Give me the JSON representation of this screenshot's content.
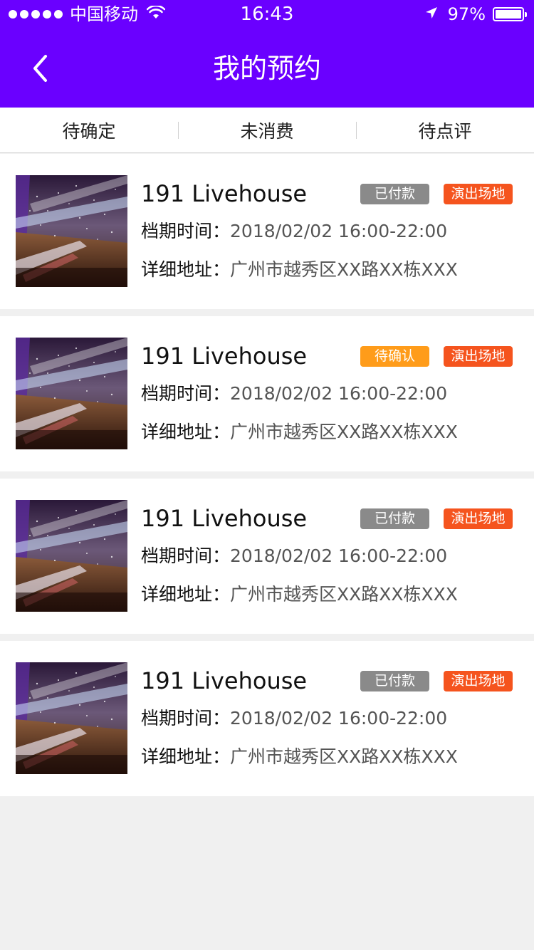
{
  "status_bar": {
    "carrier": "中国移动",
    "time": "16:43",
    "battery": "97%",
    "battery_level": 0.97,
    "signal_dots": 5,
    "icons": [
      "signal-dots-icon",
      "wifi-icon",
      "location-arrow-icon",
      "battery-icon"
    ]
  },
  "nav": {
    "title": "我的预约",
    "back_icon": "chevron-left-icon"
  },
  "tabs": [
    {
      "label": "待确定"
    },
    {
      "label": "未消费"
    },
    {
      "label": "待点评"
    }
  ],
  "list": {
    "items": [
      {
        "name": "191 Livehouse",
        "status": "已付款",
        "status_color": "#8a8a8a",
        "type": "演出场地",
        "time_label": "档期时间：",
        "time_value": "2018/02/02  16:00-22:00",
        "addr_label": "详细地址：",
        "addr_value": "广州市越秀区XX路XX栋XXX"
      },
      {
        "name": "191 Livehouse",
        "status": "待确认",
        "status_color": "#ff9c1a",
        "type": "演出场地",
        "time_label": "档期时间：",
        "time_value": "2018/02/02  16:00-22:00",
        "addr_label": "详细地址：",
        "addr_value": "广州市越秀区XX路XX栋XXX"
      },
      {
        "name": "191 Livehouse",
        "status": "已付款",
        "status_color": "#8a8a8a",
        "type": "演出场地",
        "time_label": "档期时间：",
        "time_value": "2018/02/02  16:00-22:00",
        "addr_label": "详细地址：",
        "addr_value": "广州市越秀区XX路XX栋XXX"
      },
      {
        "name": "191 Livehouse",
        "status": "已付款",
        "status_color": "#8a8a8a",
        "type": "演出场地",
        "time_label": "档期时间：",
        "time_value": "2018/02/02  16:00-22:00",
        "addr_label": "详细地址：",
        "addr_value": "广州市越秀区XX路XX栋XXX"
      }
    ]
  },
  "colors": {
    "brand": "#6a00ff",
    "type_badge": "#f5541e",
    "background": "#f0f0f0"
  }
}
